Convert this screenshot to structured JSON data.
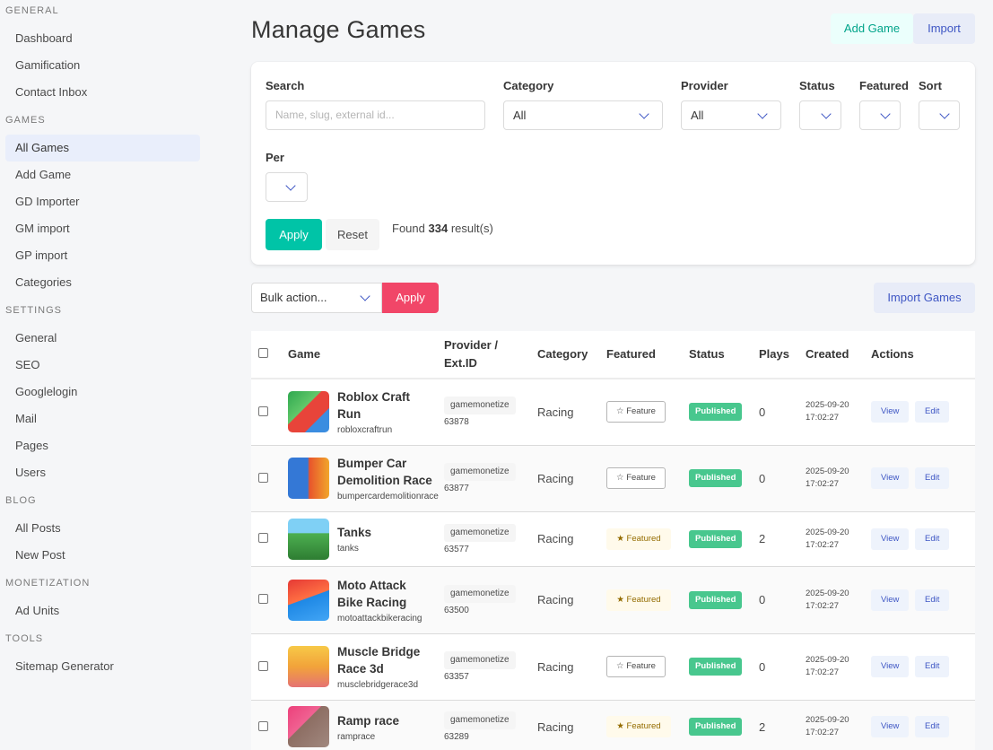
{
  "sidebar": {
    "sections": [
      {
        "label": "General",
        "items": [
          "Dashboard",
          "Gamification",
          "Contact Inbox"
        ]
      },
      {
        "label": "Games",
        "items": [
          "All Games",
          "Add Game",
          "GD Importer",
          "GM import",
          "GP import",
          "Categories"
        ]
      },
      {
        "label": "Settings",
        "items": [
          "General",
          "SEO",
          "Googlelogin",
          "Mail",
          "Pages",
          "Users"
        ]
      },
      {
        "label": "Blog",
        "items": [
          "All Posts",
          "New Post"
        ]
      },
      {
        "label": "Monetization",
        "items": [
          "Ad Units"
        ]
      },
      {
        "label": "Tools",
        "items": [
          "Sitemap Generator"
        ]
      }
    ],
    "active": "All Games"
  },
  "header": {
    "title": "Manage Games",
    "add_label": "Add Game",
    "import_label": "Import"
  },
  "filters": {
    "search_label": "Search",
    "search_placeholder": "Name, slug, external id...",
    "category_label": "Category",
    "category_value": "All",
    "provider_label": "Provider",
    "provider_value": "All",
    "status_label": "Status",
    "featured_label": "Featured",
    "sort_label": "Sort",
    "per_label": "Per",
    "apply_label": "Apply",
    "reset_label": "Reset",
    "found_prefix": "Found",
    "found_count": "334",
    "found_suffix": "result(s)"
  },
  "bulk": {
    "select_label": "Bulk action...",
    "apply_label": "Apply",
    "import_games_label": "Import Games"
  },
  "table": {
    "headers": {
      "game": "Game",
      "provider_line1": "Provider /",
      "provider_line2": "Ext.ID",
      "category": "Category",
      "featured": "Featured",
      "status": "Status",
      "plays": "Plays",
      "created": "Created",
      "actions": "Actions"
    },
    "view_label": "View",
    "edit_label": "Edit",
    "rows": [
      {
        "title": "Roblox Craft Run",
        "slug": "robloxcraftrun",
        "provider": "gamemonetize",
        "ext_id": "63878",
        "category": "Racing",
        "featured": "☆ Feature",
        "featured_on": false,
        "status": "Published",
        "plays": "0",
        "created_date": "2025-09-20",
        "created_time": "17:02:27"
      },
      {
        "title": "Bumper Car Demolition Race",
        "slug": "bumpercardemolitionrace",
        "provider": "gamemonetize",
        "ext_id": "63877",
        "category": "Racing",
        "featured": "☆ Feature",
        "featured_on": false,
        "status": "Published",
        "plays": "0",
        "created_date": "2025-09-20",
        "created_time": "17:02:27"
      },
      {
        "title": "Tanks",
        "slug": "tanks",
        "provider": "gamemonetize",
        "ext_id": "63577",
        "category": "Racing",
        "featured": "★ Featured",
        "featured_on": true,
        "status": "Published",
        "plays": "2",
        "created_date": "2025-09-20",
        "created_time": "17:02:27"
      },
      {
        "title": "Moto Attack Bike Racing",
        "slug": "motoattackbikeracing",
        "provider": "gamemonetize",
        "ext_id": "63500",
        "category": "Racing",
        "featured": "★ Featured",
        "featured_on": true,
        "status": "Published",
        "plays": "0",
        "created_date": "2025-09-20",
        "created_time": "17:02:27"
      },
      {
        "title": "Muscle Bridge Race 3d",
        "slug": "musclebridgerace3d",
        "provider": "gamemonetize",
        "ext_id": "63357",
        "category": "Racing",
        "featured": "☆ Feature",
        "featured_on": false,
        "status": "Published",
        "plays": "0",
        "created_date": "2025-09-20",
        "created_time": "17:02:27"
      },
      {
        "title": "Ramp race",
        "slug": "ramprace",
        "provider": "gamemonetize",
        "ext_id": "63289",
        "category": "Racing",
        "featured": "★ Featured",
        "featured_on": true,
        "status": "Published",
        "plays": "2",
        "created_date": "2025-09-20",
        "created_time": "17:02:27"
      }
    ]
  },
  "colors": {
    "accent": "#00c4a7",
    "danger": "#f14668",
    "link": "#3e56c4",
    "success": "#48c78e"
  }
}
